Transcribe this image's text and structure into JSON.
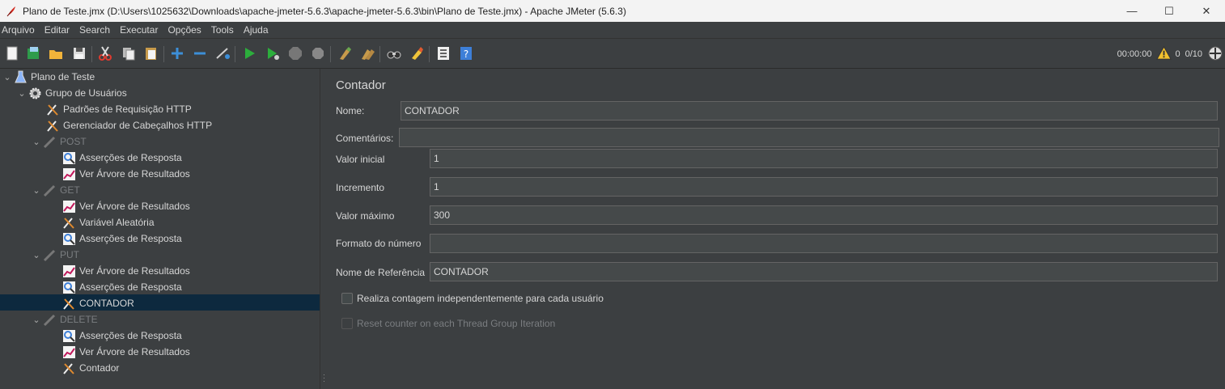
{
  "window": {
    "title": "Plano de Teste.jmx (D:\\Users\\1025632\\Downloads\\apache-jmeter-5.6.3\\apache-jmeter-5.6.3\\bin\\Plano de Teste.jmx) - Apache JMeter (5.6.3)",
    "minimize": "—",
    "maximize": "☐",
    "close": "✕"
  },
  "menu": [
    "Arquivo",
    "Editar",
    "Search",
    "Executar",
    "Opções",
    "Tools",
    "Ajuda"
  ],
  "toolbar_icons": [
    "new-icon",
    "templates-icon",
    "open-icon",
    "save-icon",
    "cut-icon",
    "copy-icon",
    "paste-icon",
    "expand-icon",
    "collapse-icon",
    "toggle-icon",
    "start-icon",
    "start-no-pauses-icon",
    "stop-icon",
    "shutdown-icon",
    "clear-icon",
    "clear-all-icon",
    "search-icon",
    "reset-search-icon",
    "function-helper-icon",
    "help-icon"
  ],
  "status": {
    "elapsed": "00:00:00",
    "warnings": "0",
    "threads": "0/10"
  },
  "tree": [
    {
      "label": "Plano de Teste",
      "icon": "test-plan-icon",
      "level": 0,
      "expanded": true,
      "disabled": false
    },
    {
      "label": "Grupo de Usuários",
      "icon": "thread-group-icon",
      "level": 1,
      "expanded": true,
      "disabled": false
    },
    {
      "label": "Padrões de Requisição HTTP",
      "icon": "config-element-icon",
      "level": 2,
      "disabled": false
    },
    {
      "label": "Gerenciador de Cabeçalhos HTTP",
      "icon": "config-element-icon",
      "level": 2,
      "disabled": false
    },
    {
      "label": "POST",
      "icon": "sampler-icon",
      "level": 2,
      "expanded": true,
      "disabled": true
    },
    {
      "label": "Asserções de Resposta",
      "icon": "assertion-icon",
      "level": 3,
      "disabled": false
    },
    {
      "label": "Ver Árvore de Resultados",
      "icon": "listener-icon",
      "level": 3,
      "disabled": false
    },
    {
      "label": "GET",
      "icon": "sampler-icon",
      "level": 2,
      "expanded": true,
      "disabled": true
    },
    {
      "label": "Ver Árvore de Resultados",
      "icon": "listener-icon",
      "level": 3,
      "disabled": false
    },
    {
      "label": "Variável Aleatória",
      "icon": "config-element-icon",
      "level": 3,
      "disabled": false
    },
    {
      "label": "Asserções de Resposta",
      "icon": "assertion-icon",
      "level": 3,
      "disabled": false
    },
    {
      "label": "PUT",
      "icon": "sampler-icon",
      "level": 2,
      "expanded": true,
      "disabled": true
    },
    {
      "label": "Ver Árvore de Resultados",
      "icon": "listener-icon",
      "level": 3,
      "disabled": false
    },
    {
      "label": "Asserções de Resposta",
      "icon": "assertion-icon",
      "level": 3,
      "disabled": false
    },
    {
      "label": "CONTADOR",
      "icon": "config-element-icon",
      "level": 3,
      "disabled": false,
      "selected": true
    },
    {
      "label": "DELETE",
      "icon": "sampler-icon",
      "level": 2,
      "expanded": true,
      "disabled": true
    },
    {
      "label": "Asserções de Resposta",
      "icon": "assertion-icon",
      "level": 3,
      "disabled": false
    },
    {
      "label": "Ver Árvore de Resultados",
      "icon": "listener-icon",
      "level": 3,
      "disabled": false
    },
    {
      "label": "Contador",
      "icon": "config-element-icon",
      "level": 3,
      "disabled": false
    }
  ],
  "form": {
    "title": "Contador",
    "name_label": "Nome:",
    "name_value": "CONTADOR",
    "comments_label": "Comentários:",
    "comments_value": "",
    "start_label": "Valor inicial",
    "start_value": "1",
    "increment_label": "Incremento",
    "increment_value": "1",
    "max_label": "Valor máximo",
    "max_value": "300",
    "format_label": "Formato do número",
    "format_value": "",
    "refname_label": "Nome de Referência",
    "refname_value": "CONTADOR",
    "per_user_label": "Realiza contagem independentemente para cada usuário",
    "per_user_checked": false,
    "reset_label": "Reset counter on each Thread Group Iteration",
    "reset_enabled": false
  }
}
